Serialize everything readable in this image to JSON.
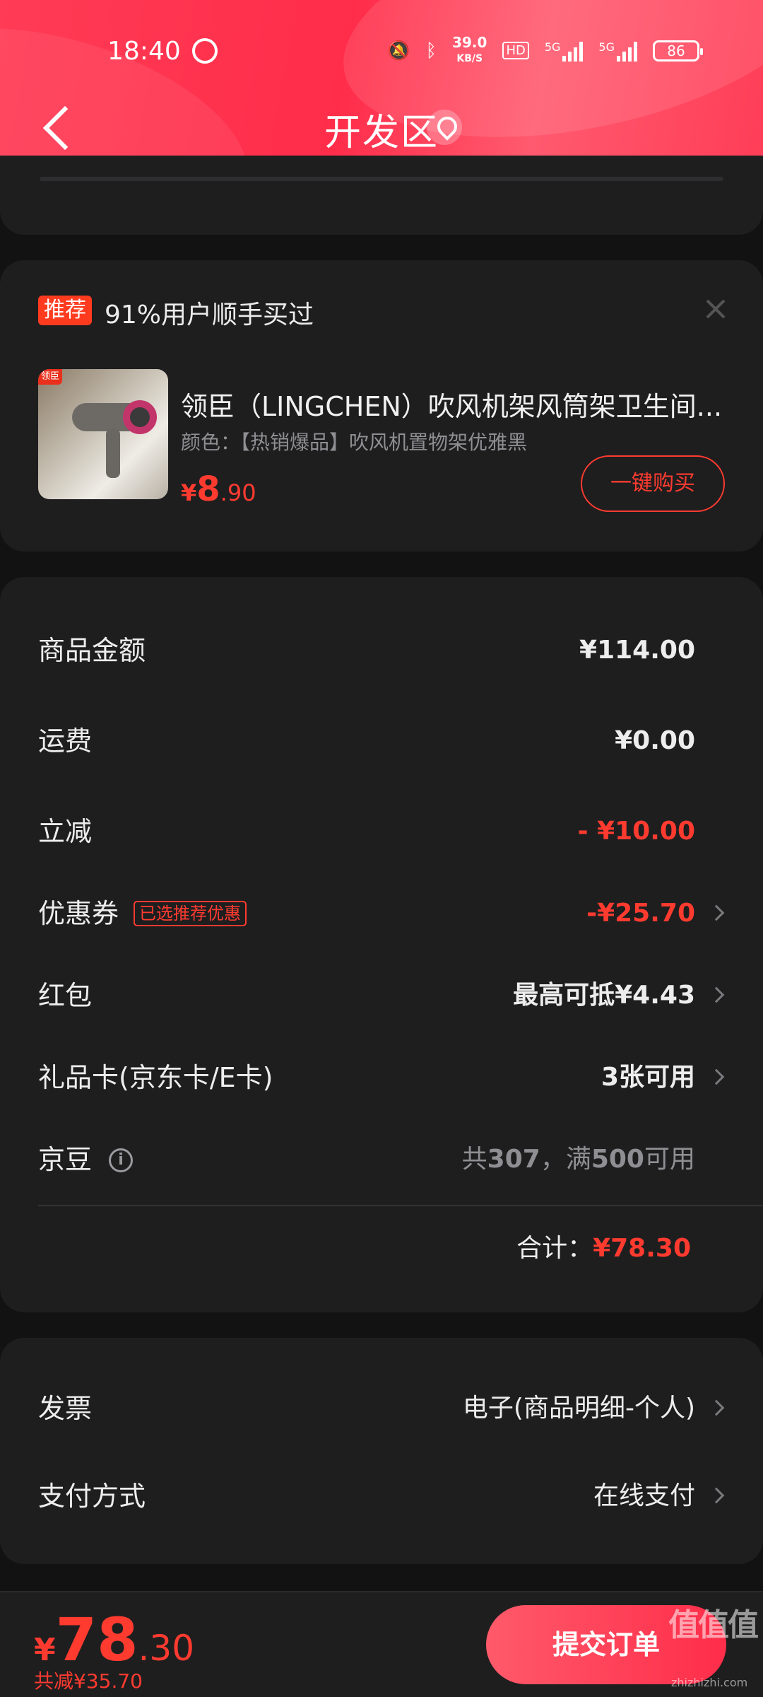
{
  "status_bar": {
    "time": "18:40",
    "net_speed_value": "39.0",
    "net_speed_unit": "KB/S",
    "hd_label": "HD",
    "network_1": "5G",
    "network_2": "5G",
    "battery": "86"
  },
  "header": {
    "title": "开发区",
    "accent_color": "#ff2d4a"
  },
  "recommendation": {
    "tag": "推荐",
    "title": "91%用户顺手买过",
    "product": {
      "image_badge": "领臣",
      "name": "领臣（LINGCHEN）吹风机架风筒架卫生间...",
      "variant": "颜色：【热销爆品】吹风机置物架优雅黑",
      "price_currency": "¥",
      "price_int": "8",
      "price_dec": ".90",
      "buy_button": "一键购买"
    }
  },
  "summary": {
    "rows": [
      {
        "label": "商品金额",
        "value": "¥114.00"
      },
      {
        "label": "运费",
        "value": "¥0.00"
      },
      {
        "label": "立减",
        "value": "- ¥10.00"
      },
      {
        "label": "优惠券",
        "tag": "已选推荐优惠",
        "value": "-¥25.70"
      },
      {
        "label": "红包",
        "value": "最高可抵¥4.43"
      },
      {
        "label": "礼品卡(京东卡/E卡)",
        "value": "3张可用"
      },
      {
        "label": "京豆",
        "value_prefix": "共",
        "value_count": "307",
        "value_mid": "，满",
        "value_threshold": "500",
        "value_suffix": "可用"
      }
    ],
    "total_label": "合计：",
    "total_amount": "¥78.30"
  },
  "invoice": {
    "rows": [
      {
        "label": "发票",
        "value": "电子(商品明细-个人)"
      },
      {
        "label": "支付方式",
        "value": "在线支付"
      }
    ]
  },
  "bottom": {
    "currency": "¥",
    "total_int": "78",
    "total_dec": ".30",
    "saved": "共减¥35.70",
    "submit": "提交订单",
    "accent_color": "#ff3b30"
  },
  "watermark": {
    "text": "值值值",
    "site": "zhizhizhi.com"
  }
}
